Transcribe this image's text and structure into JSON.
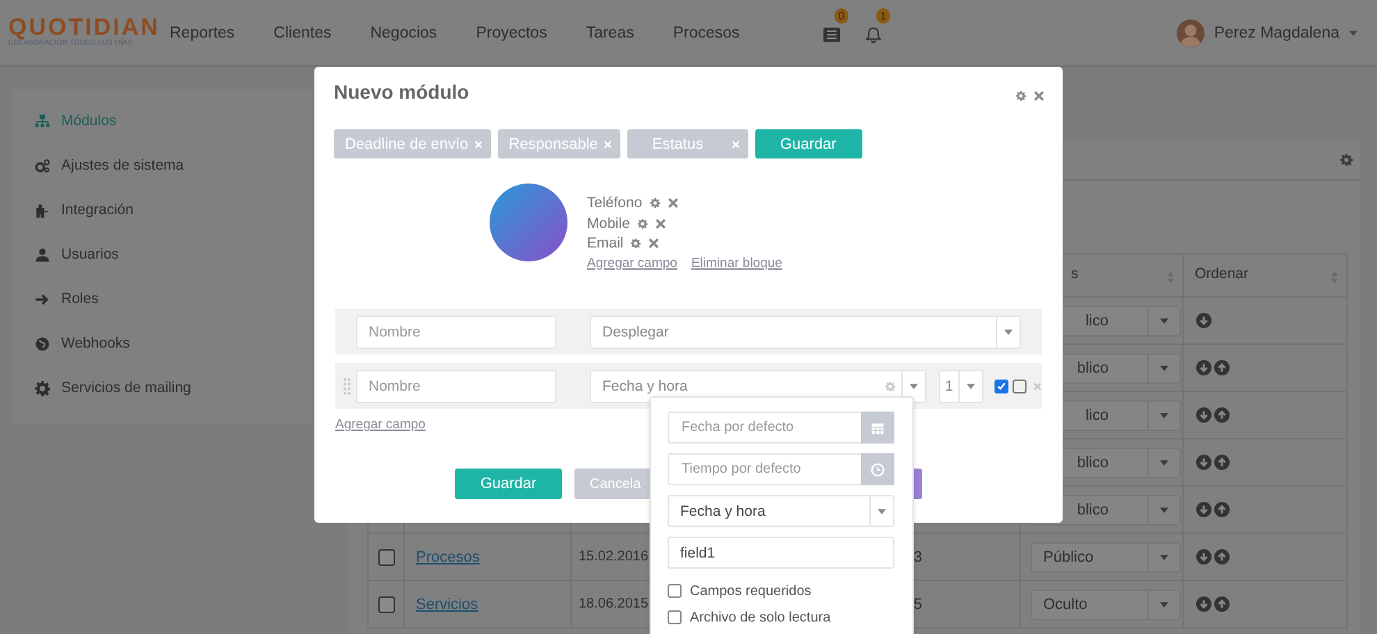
{
  "header": {
    "logo": "QUOTIDIAN",
    "tagline": "COLABORACIÓN TODOS LOS DÍAS",
    "nav": [
      "Reportes",
      "Clientes",
      "Negocios",
      "Proyectos",
      "Tareas",
      "Procesos"
    ],
    "notifications": [
      {
        "count": "0"
      },
      {
        "count": "1"
      }
    ],
    "user": {
      "name": "Perez Magdalena"
    }
  },
  "sidebar": {
    "items": [
      {
        "label": "Módulos",
        "selected": true
      },
      {
        "label": "Ajustes de sistema",
        "selected": false
      },
      {
        "label": "Integración",
        "selected": false
      },
      {
        "label": "Usuarios",
        "selected": false
      },
      {
        "label": "Roles",
        "selected": false
      },
      {
        "label": "Webhooks",
        "selected": false
      },
      {
        "label": "Servicios de mailing",
        "selected": false
      }
    ]
  },
  "table": {
    "columns": [
      {
        "label": "s",
        "kind": "partial"
      },
      {
        "label": "Ordenar",
        "kind": "full"
      }
    ],
    "rows": [
      {
        "kind": "partial",
        "status": "lico",
        "down": true,
        "up": false
      },
      {
        "kind": "partial",
        "status": "blico",
        "down": true,
        "up": true
      },
      {
        "kind": "partial",
        "status": "lico",
        "down": true,
        "up": true
      },
      {
        "kind": "partial",
        "status": "blico",
        "down": true,
        "up": true
      },
      {
        "kind": "partial",
        "status": "blico",
        "down": true,
        "up": true
      },
      {
        "kind": "full",
        "checked": false,
        "name": "Procesos",
        "date": "15.02.2016",
        "column_4": "3",
        "status": "Público",
        "down": true,
        "up": true
      },
      {
        "kind": "full",
        "checked": false,
        "name": "Servicios",
        "date": "18.06.2015",
        "column_4": "5",
        "status": "Oculto",
        "down": true,
        "up": true
      }
    ]
  },
  "modal": {
    "title": "Nuevo módulo",
    "tags": [
      {
        "label": "Deadline de envío"
      },
      {
        "label": "Responsable"
      },
      {
        "label": "Estatus"
      }
    ],
    "save": "Guardar",
    "block": {
      "fields": [
        "Teléfono",
        "Mobile",
        "Email"
      ],
      "links": [
        "Agregar campo",
        "Eliminar bloque"
      ]
    },
    "rows": [
      {
        "kind": "plain",
        "name_placeholder": "Nombre",
        "type": "Desplegar"
      },
      {
        "kind": "field",
        "name_placeholder": "Nombre",
        "type": "Fecha y hora",
        "order": "1",
        "flags": [
          {
            "checked": true
          },
          {
            "checked": false
          }
        ]
      }
    ],
    "add_field": "Agregar campo",
    "buttons": [
      {
        "label": "Guardar",
        "kind": "primary"
      },
      {
        "label": "Cancela",
        "kind": "secondary"
      },
      {
        "kind": "accent"
      }
    ]
  },
  "popover": {
    "date_placeholder": "Fecha por defecto",
    "time_placeholder": "Tiempo por defecto",
    "format": "Fecha y hora",
    "field_value": "field1",
    "options": [
      {
        "label": "Campos requeridos",
        "checked": false
      },
      {
        "label": "Archivo de solo lectura",
        "checked": false
      }
    ]
  }
}
